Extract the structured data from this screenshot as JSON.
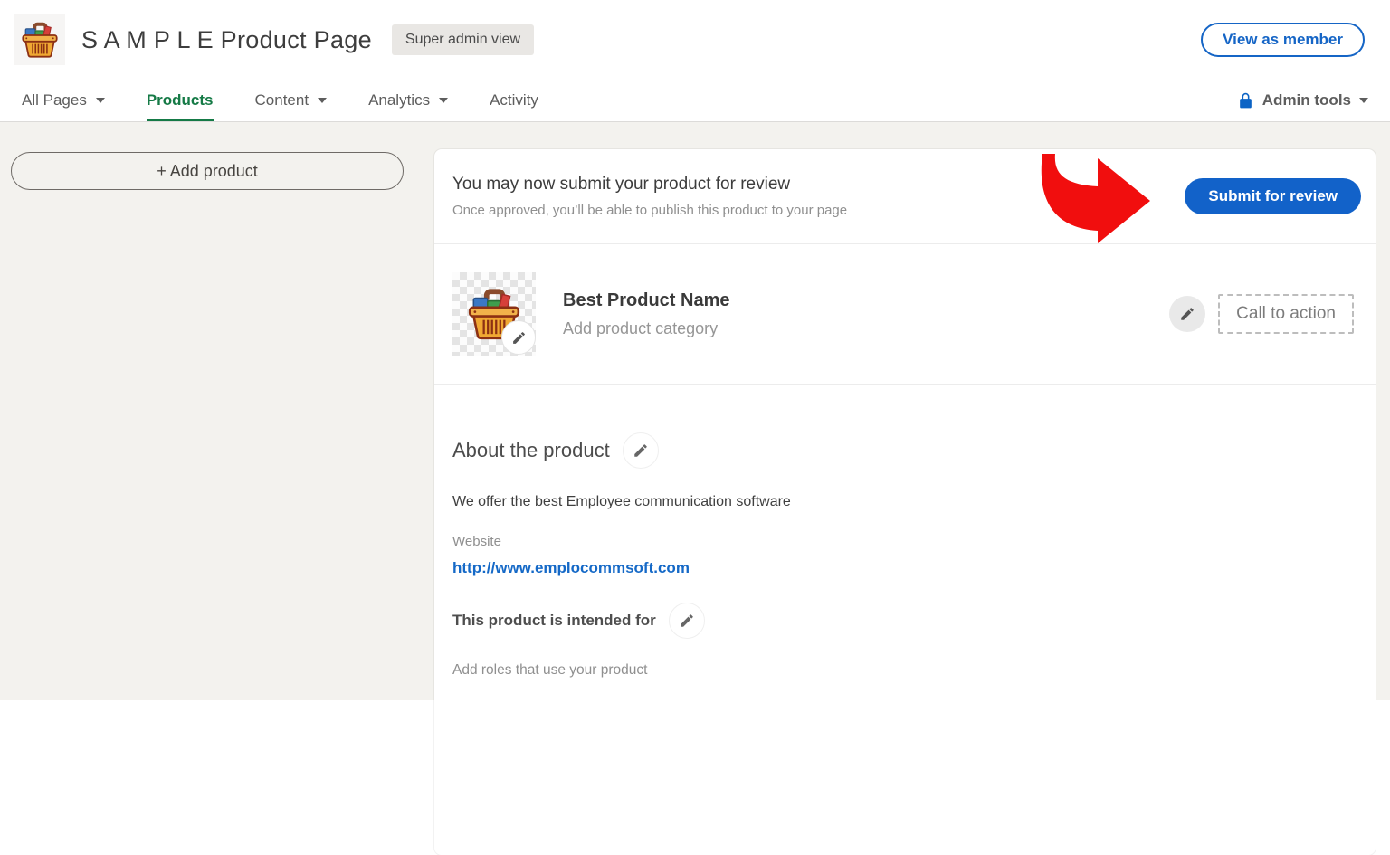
{
  "header": {
    "title": "S A M P L E Product Page",
    "badge": "Super admin view",
    "view_as_member": "View as member"
  },
  "nav": {
    "items": [
      {
        "label": "All Pages",
        "has_caret": true,
        "active": false
      },
      {
        "label": "Products",
        "has_caret": false,
        "active": true
      },
      {
        "label": "Content",
        "has_caret": true,
        "active": false
      },
      {
        "label": "Analytics",
        "has_caret": true,
        "active": false
      },
      {
        "label": "Activity",
        "has_caret": false,
        "active": false
      }
    ],
    "admin_tools": "Admin tools"
  },
  "sidebar": {
    "add_product": "+ Add product"
  },
  "review_banner": {
    "title": "You may now submit your product for review",
    "subtitle": "Once approved, you’ll be able to publish this product to your page",
    "submit_button": "Submit for review"
  },
  "product": {
    "name": "Best Product Name",
    "category_placeholder": "Add product category",
    "call_to_action": "Call to action"
  },
  "about": {
    "heading": "About the product",
    "description": "We offer the best Employee communication software",
    "website_label": "Website",
    "website_url": "http://www.emplocommsoft.com",
    "intended_for_label": "This product is intended for",
    "roles_placeholder": "Add roles that use your product"
  },
  "icons": {
    "logo": "shopping-basket-icon",
    "edit": "pencil-icon",
    "lock": "lock-icon",
    "dropdown": "chevron-down-icon",
    "annotation": "red-arrow-annotation"
  },
  "colors": {
    "accent_blue": "#1565c6",
    "primary_button_blue": "#1262c9",
    "active_tab_green": "#157a46",
    "arrow_red": "#f10e0e",
    "page_background": "#f3f2ee",
    "card_background": "#ffffff",
    "badge_background": "#e9e7e4",
    "link_blue": "#1569c7"
  }
}
